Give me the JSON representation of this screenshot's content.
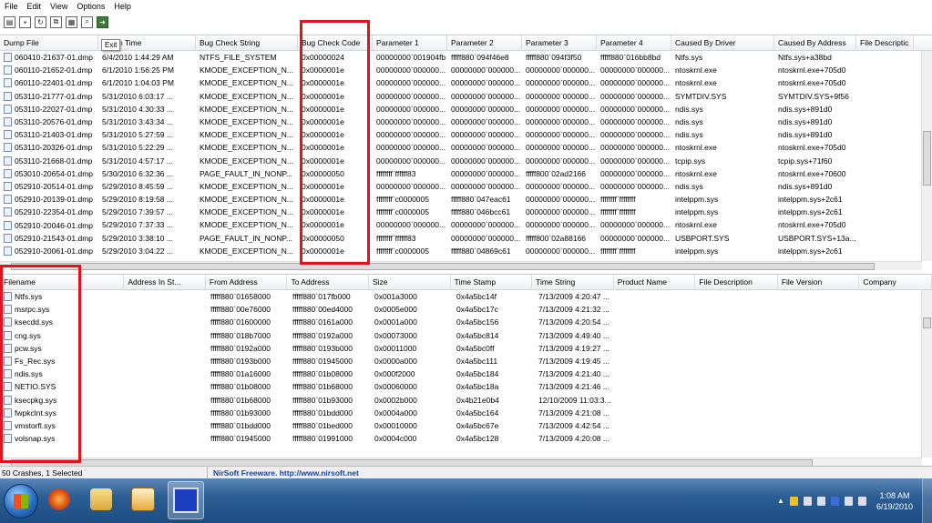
{
  "menu": [
    "File",
    "Edit",
    "View",
    "Options",
    "Help"
  ],
  "toolbar": {
    "tooltip": "Exit"
  },
  "crash_list": {
    "columns": [
      "Dump File",
      "Crash Time",
      "Bug Check String",
      "Bug Check Code",
      "Parameter 1",
      "Parameter 2",
      "Parameter 3",
      "Parameter 4",
      "Caused By Driver",
      "Caused By Address",
      "File Descriptic"
    ],
    "rows": [
      [
        "060410-21637-01.dmp",
        "6/4/2010 1:44:29 AM",
        "NTFS_FILE_SYSTEM",
        "0x00000024",
        "00000000`001904fb",
        "fffff880`094f46e8",
        "fffff880`094f3f50",
        "fffff880`016bb8bd",
        "Ntfs.sys",
        "Ntfs.sys+a38bd"
      ],
      [
        "060110-21652-01.dmp",
        "6/1/2010 1:56:25 PM",
        "KMODE_EXCEPTION_N...",
        "0x0000001e",
        "00000000`000000...",
        "00000000`000000...",
        "00000000`000000...",
        "00000000`000000...",
        "ntoskrnl.exe",
        "ntoskrnl.exe+705d0"
      ],
      [
        "060110-22401-01.dmp",
        "6/1/2010 1:04:03 PM",
        "KMODE_EXCEPTION_N...",
        "0x0000001e",
        "00000000`000000...",
        "00000000`000000...",
        "00000000`000000...",
        "00000000`000000...",
        "ntoskrnl.exe",
        "ntoskrnl.exe+705d0"
      ],
      [
        "053110-21777-01.dmp",
        "5/31/2010 6:03:17 ...",
        "KMODE_EXCEPTION_N...",
        "0x0000001e",
        "00000000`000000...",
        "00000000`000000...",
        "00000000`000000...",
        "00000000`000000...",
        "SYMTDIV.SYS",
        "SYMTDIV.SYS+9f56"
      ],
      [
        "053110-22027-01.dmp",
        "5/31/2010 4:30:33 ...",
        "KMODE_EXCEPTION_N...",
        "0x0000001e",
        "00000000`000000...",
        "00000000`000000...",
        "00000000`000000...",
        "00000000`000000...",
        "ndis.sys",
        "ndis.sys+891d0"
      ],
      [
        "053110-20576-01.dmp",
        "5/31/2010 3:43:34 ...",
        "KMODE_EXCEPTION_N...",
        "0x0000001e",
        "00000000`000000...",
        "00000000`000000...",
        "00000000`000000...",
        "00000000`000000...",
        "ndis.sys",
        "ndis.sys+891d0"
      ],
      [
        "053110-21403-01.dmp",
        "5/31/2010 5:27:59 ...",
        "KMODE_EXCEPTION_N...",
        "0x0000001e",
        "00000000`000000...",
        "00000000`000000...",
        "00000000`000000...",
        "00000000`000000...",
        "ndis.sys",
        "ndis.sys+891d0"
      ],
      [
        "053110-20326-01.dmp",
        "5/31/2010 5:22:29 ...",
        "KMODE_EXCEPTION_N...",
        "0x0000001e",
        "00000000`000000...",
        "00000000`000000...",
        "00000000`000000...",
        "00000000`000000...",
        "ntoskrnl.exe",
        "ntoskrnl.exe+705d0"
      ],
      [
        "053110-21668-01.dmp",
        "5/31/2010 4:57:17 ...",
        "KMODE_EXCEPTION_N...",
        "0x0000001e",
        "00000000`000000...",
        "00000000`000000...",
        "00000000`000000...",
        "00000000`000000...",
        "tcpip.sys",
        "tcpip.sys+71f60"
      ],
      [
        "053010-20654-01.dmp",
        "5/30/2010 6:32:36 ...",
        "PAGE_FAULT_IN_NONP...",
        "0x00000050",
        "ffffffff`ffffff83",
        "00000000`000000...",
        "fffff800`02ad2166",
        "00000000`000000...",
        "ntoskrnl.exe",
        "ntoskrnl.exe+70600"
      ],
      [
        "052910-20514-01.dmp",
        "5/29/2010 8:45:59 ...",
        "KMODE_EXCEPTION_N...",
        "0x0000001e",
        "00000000`000000...",
        "00000000`000000...",
        "00000000`000000...",
        "00000000`000000...",
        "ndis.sys",
        "ndis.sys+891d0"
      ],
      [
        "052910-20139-01.dmp",
        "5/29/2010 8:19:58 ...",
        "KMODE_EXCEPTION_N...",
        "0x0000001e",
        "ffffffff`c0000005",
        "fffff880`047eac61",
        "00000000`000000...",
        "ffffffff`ffffffff",
        "intelppm.sys",
        "intelppm.sys+2c61"
      ],
      [
        "052910-22354-01.dmp",
        "5/29/2010 7:39:57 ...",
        "KMODE_EXCEPTION_N...",
        "0x0000001e",
        "ffffffff`c0000005",
        "fffff880`046bcc61",
        "00000000`000000...",
        "ffffffff`ffffffff",
        "intelppm.sys",
        "intelppm.sys+2c61"
      ],
      [
        "052910-20046-01.dmp",
        "5/29/2010 7:37:33 ...",
        "KMODE_EXCEPTION_N...",
        "0x0000001e",
        "00000000`000000...",
        "00000000`000000...",
        "00000000`000000...",
        "00000000`000000...",
        "ntoskrnl.exe",
        "ntoskrnl.exe+705d0"
      ],
      [
        "052910-21543-01.dmp",
        "5/29/2010 3:38:10 ...",
        "PAGE_FAULT_IN_NONP...",
        "0x00000050",
        "ffffffff`ffffff83",
        "00000000`000000...",
        "fffff800`02a88166",
        "00000000`000000...",
        "USBPORT.SYS",
        "USBPORT.SYS+13a..."
      ],
      [
        "052910-20061-01.dmp",
        "5/29/2010 3:04:22 ...",
        "KMODE_EXCEPTION_N...",
        "0x0000001e",
        "ffffffff`c0000005",
        "fffff880`04869c61",
        "00000000`000000...",
        "ffffffff`ffffffff",
        "intelppm.sys",
        "intelppm.sys+2c61"
      ]
    ]
  },
  "driver_list": {
    "columns": [
      "Filename",
      "Address In St...",
      "From Address",
      "To Address",
      "Size",
      "Time Stamp",
      "Time String",
      "Product Name",
      "File Description",
      "File Version",
      "Company"
    ],
    "rows": [
      [
        "Ntfs.sys",
        "",
        "fffff880`01658000",
        "fffff880`017fb000",
        "0x001a3000",
        "0x4a5bc14f",
        "7/13/2009 4:20:47 ..."
      ],
      [
        "msrpc.sys",
        "",
        "fffff880`00e76000",
        "fffff880`00ed4000",
        "0x0005e000",
        "0x4a5bc17c",
        "7/13/2009 4:21:32 ..."
      ],
      [
        "ksecdd.sys",
        "",
        "fffff880`01600000",
        "fffff880`0161a000",
        "0x0001a000",
        "0x4a5bc156",
        "7/13/2009 4:20:54 ..."
      ],
      [
        "cng.sys",
        "",
        "fffff880`018b7000",
        "fffff880`0192a000",
        "0x00073000",
        "0x4a5bc814",
        "7/13/2009 4:49:40 ..."
      ],
      [
        "pcw.sys",
        "",
        "fffff880`0192a000",
        "fffff880`0193b000",
        "0x00011000",
        "0x4a5bc0ff",
        "7/13/2009 4:19:27 ..."
      ],
      [
        "Fs_Rec.sys",
        "",
        "fffff880`0193b000",
        "fffff880`01945000",
        "0x0000a000",
        "0x4a5bc111",
        "7/13/2009 4:19:45 ..."
      ],
      [
        "ndis.sys",
        "",
        "fffff880`01a16000",
        "fffff880`01b08000",
        "0x000f2000",
        "0x4a5bc184",
        "7/13/2009 4:21:40 ..."
      ],
      [
        "NETIO.SYS",
        "",
        "fffff880`01b08000",
        "fffff880`01b68000",
        "0x00060000",
        "0x4a5bc18a",
        "7/13/2009 4:21:46 ..."
      ],
      [
        "ksecpkg.sys",
        "",
        "fffff880`01b68000",
        "fffff880`01b93000",
        "0x0002b000",
        "0x4b21e0b4",
        "12/10/2009 11:03:3..."
      ],
      [
        "fwpkclnt.sys",
        "",
        "fffff880`01b93000",
        "fffff880`01bdd000",
        "0x0004a000",
        "0x4a5bc164",
        "7/13/2009 4:21:08 ..."
      ],
      [
        "vmstorfl.sys",
        "",
        "fffff880`01bdd000",
        "fffff880`01bed000",
        "0x00010000",
        "0x4a5bc67e",
        "7/13/2009 4:42:54 ..."
      ],
      [
        "volsnap.sys",
        "",
        "fffff880`01945000",
        "fffff880`01991000",
        "0x0004c000",
        "0x4a5bc128",
        "7/13/2009 4:20:08 ..."
      ]
    ]
  },
  "status": {
    "count": "50 Crashes, 1 Selected",
    "link": "NirSoft Freeware.  http://www.nirsoft.net"
  },
  "clock": {
    "time": "1:08 AM",
    "date": "6/19/2010"
  }
}
